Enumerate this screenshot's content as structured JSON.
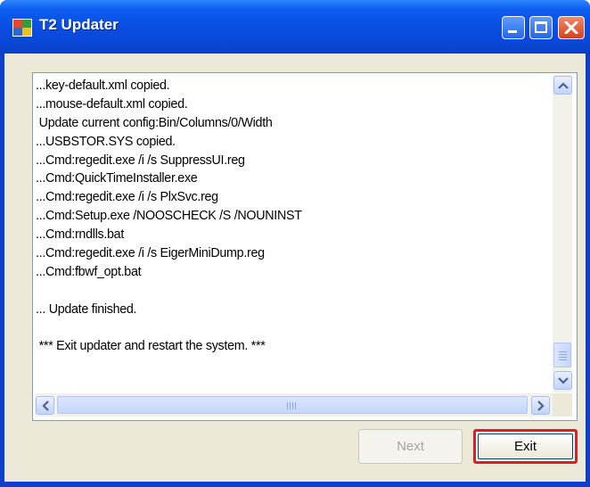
{
  "window": {
    "title": "T2 Updater"
  },
  "log": {
    "lines": [
      "...key-default.xml copied.",
      "...mouse-default.xml copied.",
      " Update current config:Bin/Columns/0/Width",
      "...USBSTOR.SYS copied.",
      "...Cmd:regedit.exe /i /s SuppressUI.reg",
      "...Cmd:QuickTimeInstaller.exe",
      "...Cmd:regedit.exe /i /s PlxSvc.reg",
      "...Cmd:Setup.exe /NOOSCHECK /S /NOUNINST",
      "...Cmd:rndlls.bat",
      "...Cmd:regedit.exe /i /s EigerMiniDump.reg",
      "...Cmd:fbwf_opt.bat",
      "",
      "... Update finished.",
      "",
      " *** Exit updater and restart the system. ***"
    ]
  },
  "buttons": {
    "next_label": "Next",
    "exit_label": "Exit"
  },
  "colors": {
    "titlebar": "#0a4ce0",
    "highlight": "#e01c24"
  },
  "icons": {
    "app": "app-icon",
    "minimize": "minimize-icon",
    "maximize": "maximize-icon",
    "close": "close-icon"
  }
}
